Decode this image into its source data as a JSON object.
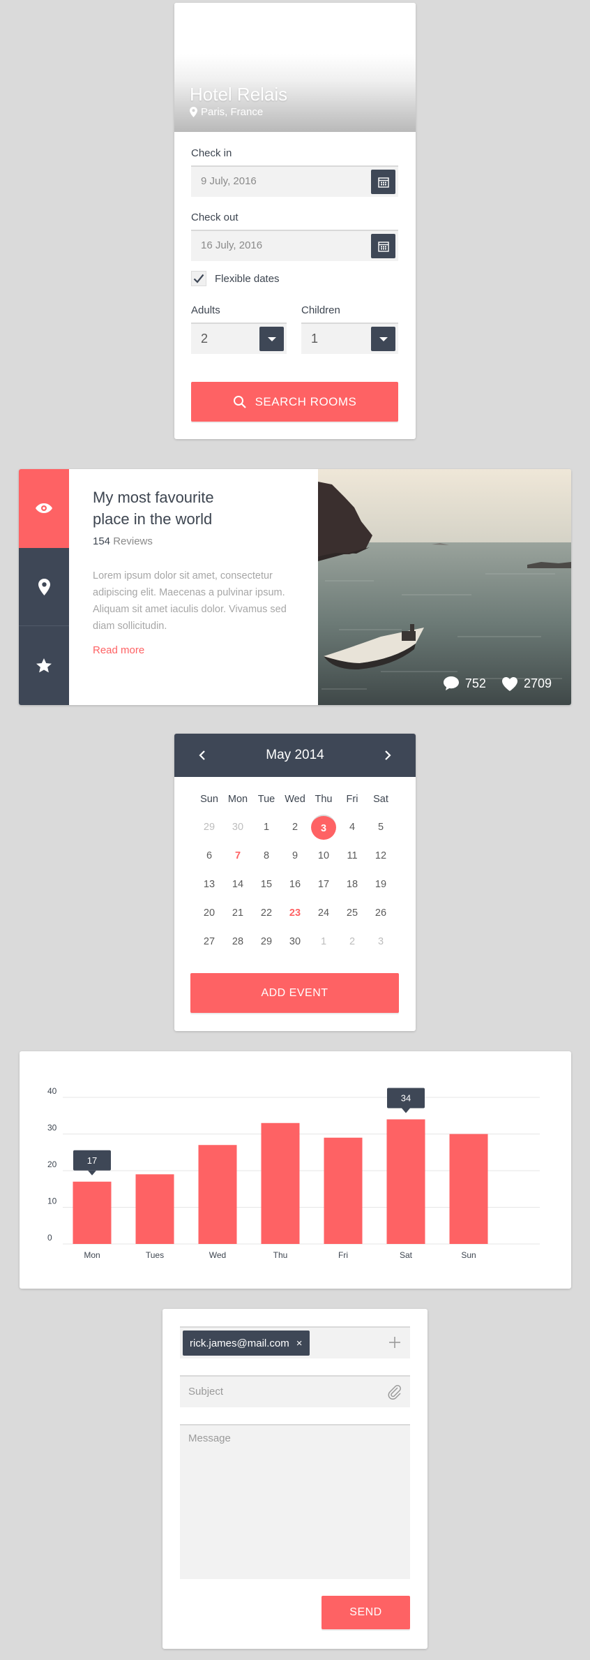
{
  "colors": {
    "accent": "#fe6264",
    "dark": "#3e4756",
    "field": "#f2f2f2",
    "background": "#dadada"
  },
  "hotel": {
    "name": "Hotel Relais",
    "location": "Paris, France",
    "check_in_label": "Check in",
    "check_in_value": "9 July, 2016",
    "check_out_label": "Check out",
    "check_out_value": "16 July, 2016",
    "flexible_label": "Flexible dates",
    "flexible_checked": true,
    "adults_label": "Adults",
    "adults_value": "2",
    "children_label": "Children",
    "children_value": "1",
    "search_label": "SEARCH ROOMS",
    "icons": [
      "map-pin-icon",
      "calendar-icon",
      "check-icon",
      "chevron-down-icon",
      "search-icon"
    ]
  },
  "article": {
    "tabs": [
      {
        "icon": "eye-icon",
        "active": true
      },
      {
        "icon": "map-pin-icon",
        "active": false
      },
      {
        "icon": "star-icon",
        "active": false
      }
    ],
    "title": "My most favourite place in the world",
    "review_count": "154",
    "review_word": "Reviews",
    "body": "Lorem ipsum dolor sit amet, consectetur adipiscing elit. Maecenas a pulvinar ipsum. Aliquam sit amet iaculis dolor. Vivamus sed diam sollicitudin.",
    "read_more": "Read more",
    "comments": "752",
    "likes": "2709"
  },
  "calendar": {
    "month": "May 2014",
    "weekdays": [
      "Sun",
      "Mon",
      "Tue",
      "Wed",
      "Thu",
      "Fri",
      "Sat"
    ],
    "weeks": [
      [
        "29",
        "30",
        "1",
        "2",
        "3",
        "4",
        "5"
      ],
      [
        "6",
        "7",
        "8",
        "9",
        "10",
        "11",
        "12"
      ],
      [
        "13",
        "14",
        "15",
        "16",
        "17",
        "18",
        "19"
      ],
      [
        "20",
        "21",
        "22",
        "23",
        "24",
        "25",
        "26"
      ],
      [
        "27",
        "28",
        "29",
        "30",
        "1",
        "2",
        "3"
      ]
    ],
    "muted_days": [
      "0-0",
      "0-1",
      "4-4",
      "4-5",
      "4-6"
    ],
    "selected_day": "3",
    "highlighted_days": [
      "7",
      "23"
    ],
    "add_label": "ADD EVENT"
  },
  "chart_data": {
    "type": "bar",
    "categories": [
      "Mon",
      "Tues",
      "Wed",
      "Thu",
      "Fri",
      "Sat",
      "Sun"
    ],
    "values": [
      17,
      19,
      27,
      33,
      29,
      34,
      30
    ],
    "yticks": [
      0,
      10,
      20,
      30,
      40
    ],
    "ylim": [
      0,
      40
    ],
    "grid": true,
    "bar_color": "#fe6264",
    "callouts": [
      {
        "category": "Mon",
        "label": "17"
      },
      {
        "category": "Sat",
        "label": "34"
      }
    ],
    "title": "",
    "xlabel": "",
    "ylabel": ""
  },
  "mail": {
    "recipient": "rick.james@mail.com",
    "remove_glyph": "×",
    "subject_placeholder": "Subject",
    "message_placeholder": "Message",
    "send_label": "SEND"
  }
}
